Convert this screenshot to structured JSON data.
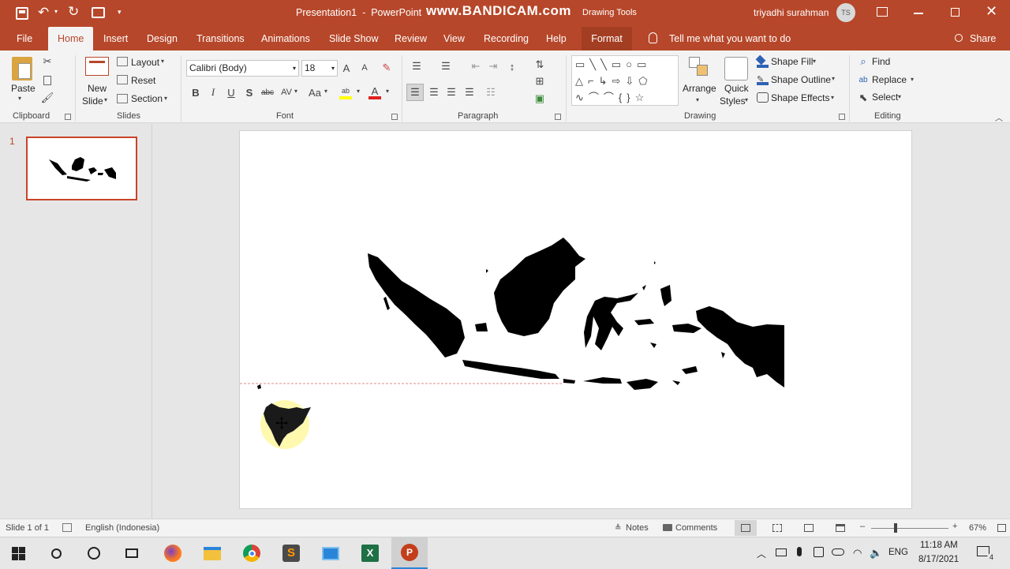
{
  "titlebar": {
    "doc_title": "Presentation1  -  PowerPoint",
    "watermark": "www.BANDICAM.com",
    "context_label": "Drawing Tools",
    "user_name": "triyadhi surahman",
    "user_initials": "TS"
  },
  "tabs": [
    "File",
    "Home",
    "Insert",
    "Design",
    "Transitions",
    "Animations",
    "Slide Show",
    "Review",
    "View",
    "Recording",
    "Help",
    "Format"
  ],
  "active_tab": "Home",
  "tell_me": "Tell me what you want to do",
  "share": "Share",
  "ribbon": {
    "clipboard": {
      "paste": "Paste",
      "label": "Clipboard"
    },
    "slides": {
      "new_slide_1": "New",
      "new_slide_2": "Slide",
      "layout": "Layout",
      "reset": "Reset",
      "section": "Section",
      "label": "Slides"
    },
    "font": {
      "font_name": "Calibri (Body)",
      "font_size": "18",
      "bold": "B",
      "italic": "I",
      "underline": "U",
      "shadow": "S",
      "strike": "abc",
      "spacing": "AV",
      "case": "Aa",
      "label": "Font"
    },
    "paragraph": {
      "label": "Paragraph"
    },
    "drawing": {
      "arrange": "Arrange",
      "quick_styles_1": "Quick",
      "quick_styles_2": "Styles",
      "shape_fill": "Shape Fill",
      "shape_outline": "Shape Outline",
      "shape_effects": "Shape Effects",
      "label": "Drawing"
    },
    "editing": {
      "find": "Find",
      "replace": "Replace",
      "select": "Select",
      "label": "Editing"
    }
  },
  "thumbnails": [
    {
      "number": "1"
    }
  ],
  "status": {
    "slide": "Slide 1 of 1",
    "language": "English (Indonesia)",
    "notes": "Notes",
    "comments": "Comments",
    "zoom": "67%"
  },
  "taskbar": {
    "language": "ENG",
    "time": "11:18 AM",
    "date": "8/17/2021",
    "notification_count": "4"
  },
  "colors": {
    "accent": "#b7472a",
    "selection_highlight": "#fff9b0",
    "map_fill": "#000000"
  },
  "icons": [
    "save-icon",
    "undo-icon",
    "redo-icon",
    "start-icon",
    "search-icon",
    "cortana-icon",
    "task-view-icon",
    "firefox-icon",
    "file-explorer-icon",
    "chrome-icon",
    "sublime-icon",
    "excel-icon",
    "powerpoint-icon"
  ]
}
